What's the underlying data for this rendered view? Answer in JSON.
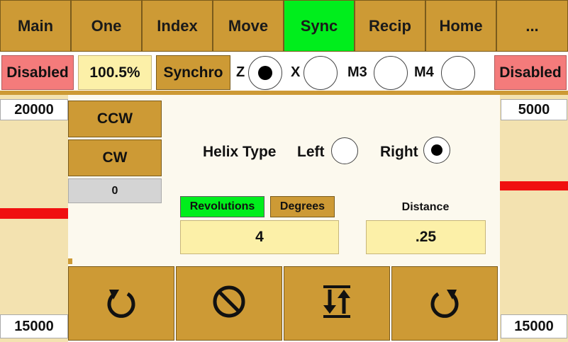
{
  "tabs": [
    {
      "label": "Main"
    },
    {
      "label": "One"
    },
    {
      "label": "Index"
    },
    {
      "label": "Move"
    },
    {
      "label": "Sync",
      "active": true
    },
    {
      "label": "Recip"
    },
    {
      "label": "Home"
    },
    {
      "label": "..."
    }
  ],
  "status": {
    "left_state": "Disabled",
    "percent": "100.5%",
    "mode_button": "Synchro",
    "right_state": "Disabled",
    "axes": [
      {
        "label": "Z",
        "selected": true
      },
      {
        "label": "X",
        "selected": false
      },
      {
        "label": "M3",
        "selected": false
      },
      {
        "label": "M4",
        "selected": false
      }
    ]
  },
  "left_panel": {
    "top_value": "20000",
    "bottom_value": "15000"
  },
  "right_panel": {
    "top_value": "5000",
    "bottom_value": "15000"
  },
  "direction": {
    "ccw_label": "CCW",
    "cw_label": "CW",
    "counter": "0"
  },
  "helix": {
    "title": "Helix Type",
    "left_label": "Left",
    "right_label": "Right",
    "selected": "Right"
  },
  "units": {
    "revolutions_label": "Revolutions",
    "degrees_label": "Degrees",
    "value": "4"
  },
  "distance": {
    "label": "Distance",
    "value": ".25"
  },
  "actions": [
    {
      "name": "rotate-ccw-icon"
    },
    {
      "name": "stop-icon"
    },
    {
      "name": "sync-arrows-icon"
    },
    {
      "name": "rotate-cw-icon"
    }
  ],
  "colors": {
    "button": "#cd9a35",
    "active_tab": "#00ee1c",
    "disabled": "#f47b7b",
    "value_field": "#fcf0a8",
    "panel": "#fcf9ee",
    "sidebar": "#f3e2b0",
    "indicator": "#f01010"
  }
}
